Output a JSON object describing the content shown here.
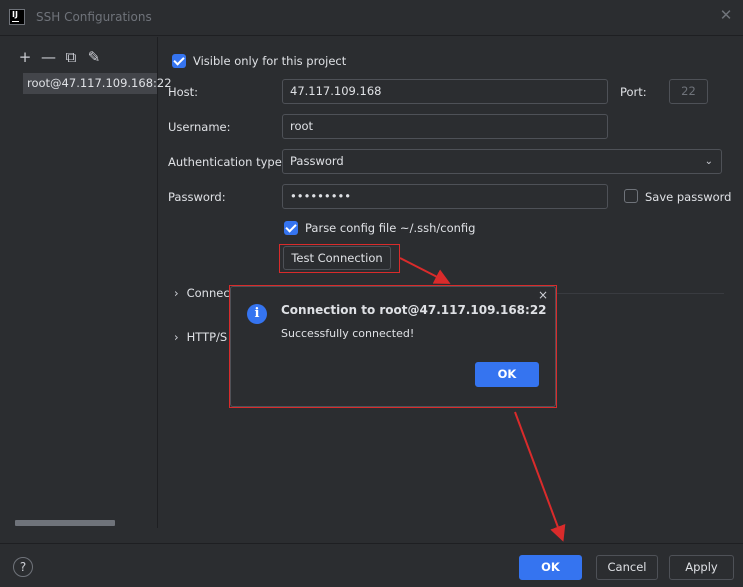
{
  "window": {
    "app_icon": "intellij-icon",
    "app_icon_text": "IJ",
    "title": "SSH Configurations",
    "close_icon": "close-icon"
  },
  "sidebar": {
    "toolbar": [
      {
        "name": "add-icon",
        "glyph": "+"
      },
      {
        "name": "remove-icon",
        "glyph": "—"
      },
      {
        "name": "copy-icon",
        "glyph": "⧉"
      },
      {
        "name": "edit-icon",
        "glyph": "✎"
      }
    ],
    "items": [
      {
        "label": "root@47.117.109.168:22",
        "selected": true
      }
    ]
  },
  "form": {
    "visible_only": {
      "label": "Visible only for this project",
      "checked": true
    },
    "host": {
      "label": "Host:",
      "value": "47.117.109.168"
    },
    "port": {
      "label": "Port:",
      "value": "22"
    },
    "username": {
      "label": "Username:",
      "value": "root"
    },
    "auth_type": {
      "label": "Authentication type:",
      "value": "Password"
    },
    "password": {
      "label": "Password:",
      "value": "•••••••••"
    },
    "save_password": {
      "label": "Save password",
      "checked": false
    },
    "parse_config": {
      "label": "Parse config file ~/.ssh/config",
      "checked": true
    },
    "test_connection": "Test Connection",
    "sections": [
      {
        "label": "Connec"
      },
      {
        "label": "HTTP/S"
      }
    ]
  },
  "dialog": {
    "icon": "info-icon",
    "title": "Connection to root@47.117.109.168:22",
    "message": "Successfully connected!",
    "ok": "OK",
    "close_glyph": "×"
  },
  "footer": {
    "help": "?",
    "ok": "OK",
    "cancel": "Cancel",
    "apply": "Apply"
  },
  "colors": {
    "accent": "#3574f0",
    "annotation": "#d92b2b",
    "background": "#2b2d30"
  }
}
